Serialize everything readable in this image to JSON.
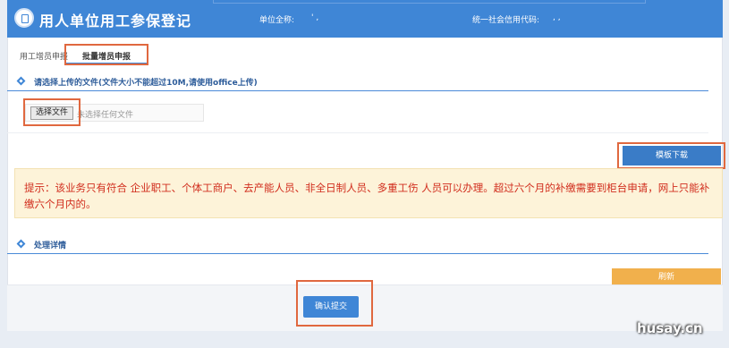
{
  "header": {
    "title": "用人单位用工参保登记",
    "unit_label": "单位全称:",
    "unit_value": "'   ,",
    "code_label": "统一社会信用代码:",
    "code_value": ",    ,"
  },
  "tabs": [
    {
      "label": "用工增员申报"
    },
    {
      "label": "批量增员申报"
    }
  ],
  "upload": {
    "section_title": "请选择上传的文件(文件大小不能超过10M,请使用office上传)",
    "choose_button": "选择文件",
    "file_status": "未选择任何文件"
  },
  "template_button": "模板下载",
  "notice": {
    "text": "提示：该业务只有符合 企业职工、个体工商户、去产能人员、非全日制人员、多重工伤 人员可以办理。超过六个月的补缴需要到柜台申请，网上只能补缴六个月内的。"
  },
  "details": {
    "section_title": "处理详情"
  },
  "refresh_button": "刷新",
  "submit_button": "确认提交",
  "watermark": "husay.cn",
  "colors": {
    "header_bg": "#3f86d6",
    "highlight": "#e0683f",
    "notice_text": "#d12d1d",
    "refresh_bg": "#f1b04c"
  }
}
